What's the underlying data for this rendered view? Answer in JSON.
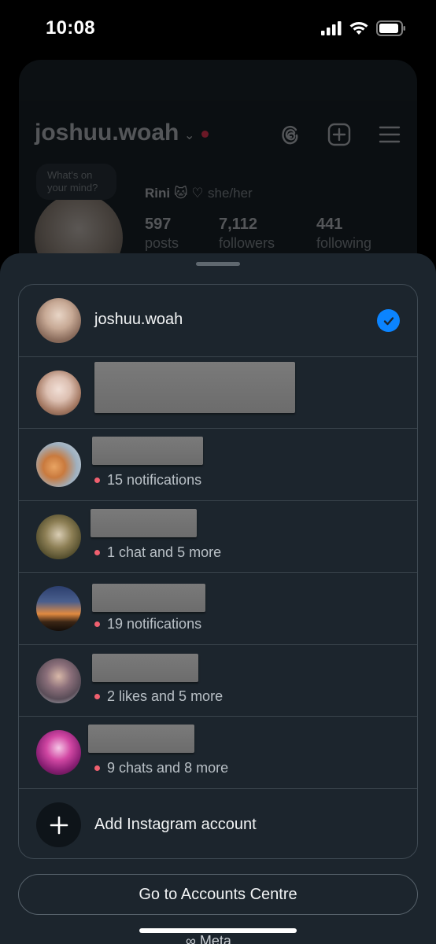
{
  "status_bar": {
    "time": "10:08"
  },
  "profile": {
    "username": "joshuu.woah",
    "note": "What's on your mind?",
    "display_name": "Rini",
    "pronouns": "she/her",
    "stats": [
      {
        "value": "597",
        "label": "posts"
      },
      {
        "value": "7,112",
        "label": "followers"
      },
      {
        "value": "441",
        "label": "following"
      }
    ]
  },
  "accounts": [
    {
      "name": "joshuu.woah",
      "status": "",
      "selected": true
    },
    {
      "name": "",
      "status": "",
      "selected": false
    },
    {
      "name": "",
      "status": "15 notifications",
      "selected": false
    },
    {
      "name": "",
      "status": "1 chat and 5 more",
      "selected": false
    },
    {
      "name": "",
      "status": "19 notifications",
      "selected": false
    },
    {
      "name": "",
      "status": "2 likes and 5 more",
      "selected": false
    },
    {
      "name": "",
      "status": "9 chats and 8 more",
      "selected": false
    }
  ],
  "add_account": {
    "label": "Add Instagram account"
  },
  "accounts_centre": {
    "label": "Go to Accounts Centre"
  },
  "peek_text": "Meta",
  "colors": {
    "accent": "#0b84ff",
    "sheet": "#1c252d",
    "notif_dot": "#f0606f"
  },
  "icons": [
    "threads-icon",
    "create-post-icon",
    "menu-icon",
    "checkmark-icon",
    "plus-icon",
    "signal-icon",
    "wifi-icon",
    "battery-icon"
  ]
}
